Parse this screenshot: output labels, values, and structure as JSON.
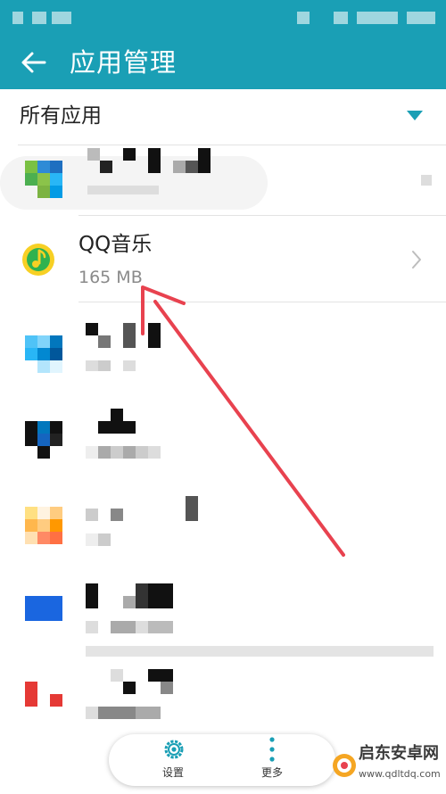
{
  "header": {
    "title": "应用管理",
    "back_icon": "back-arrow-icon"
  },
  "filter": {
    "label": "所有应用",
    "dropdown_icon": "dropdown-triangle-icon"
  },
  "apps": {
    "qq_music": {
      "name": "QQ音乐",
      "size": "165 MB",
      "chevron_icon": "chevron-right-icon"
    }
  },
  "bottom_bar": {
    "settings_label": "设置",
    "more_label": "更多"
  },
  "watermark": {
    "text": "启东安卓网",
    "url": "www.qdltdq.com"
  },
  "colors": {
    "accent": "#1a9fb5",
    "annotation_arrow": "#e8424f",
    "qq_green": "#2fb24f",
    "qq_yellow": "#f7d024"
  }
}
